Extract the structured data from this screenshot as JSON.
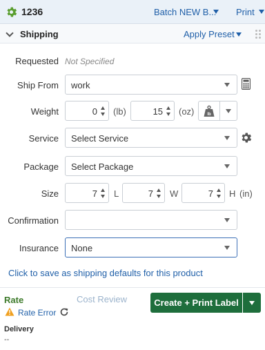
{
  "header": {
    "order_number": "1236",
    "batch_label": "Batch NEW B...",
    "print_label": "Print"
  },
  "section": {
    "title": "Shipping",
    "apply_preset_label": "Apply Preset"
  },
  "form": {
    "requested": {
      "label": "Requested",
      "value": "Not Specified"
    },
    "ship_from": {
      "label": "Ship From",
      "value": "work"
    },
    "weight": {
      "label": "Weight",
      "lb_value": "0",
      "lb_unit": "(lb)",
      "oz_value": "15",
      "oz_unit": "(oz)"
    },
    "service": {
      "label": "Service",
      "value": "Select Service"
    },
    "package": {
      "label": "Package",
      "value": "Select Package"
    },
    "size": {
      "label": "Size",
      "length": "7",
      "length_unit": "L",
      "width": "7",
      "width_unit": "W",
      "height": "7",
      "height_unit": "H",
      "unit": "(in)"
    },
    "confirmation": {
      "label": "Confirmation",
      "value": ""
    },
    "insurance": {
      "label": "Insurance",
      "value": "None"
    }
  },
  "save_defaults_link": "Click to save as shipping defaults for this product",
  "rate": {
    "title": "Rate",
    "cost_review": "Cost Review",
    "error_text": "Rate Error",
    "create_button": "Create + Print Label"
  },
  "delivery": {
    "title": "Delivery",
    "value": "--"
  },
  "colors": {
    "accent_link": "#1f5fa8",
    "primary_button": "#1e6e3c",
    "rate_green": "#3d7a2a",
    "warning": "#f0a020"
  },
  "icons": {
    "top_left": "gear-icon",
    "ship_from_action": "calculator-icon",
    "weight_action": "scale-icon",
    "service_action": "gear-icon",
    "rate_error": "warning-icon",
    "refresh": "refresh-icon"
  }
}
